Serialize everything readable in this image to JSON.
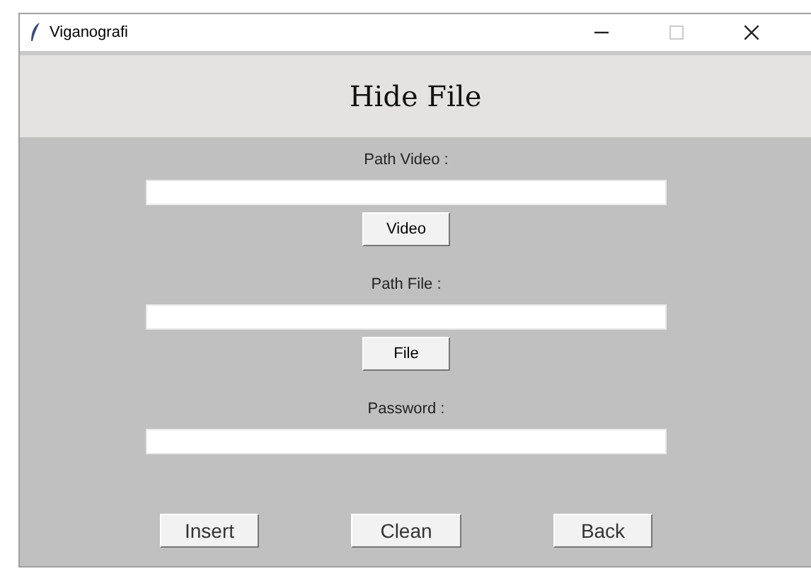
{
  "window": {
    "title": "Viganografi"
  },
  "header": {
    "title": "Hide File"
  },
  "fields": [
    {
      "label": "Path Video :",
      "button": "Video"
    },
    {
      "label": "Path File :",
      "button": "File"
    },
    {
      "label": "Password :"
    }
  ],
  "buttons": [
    "Insert",
    "Clean",
    "Back"
  ]
}
